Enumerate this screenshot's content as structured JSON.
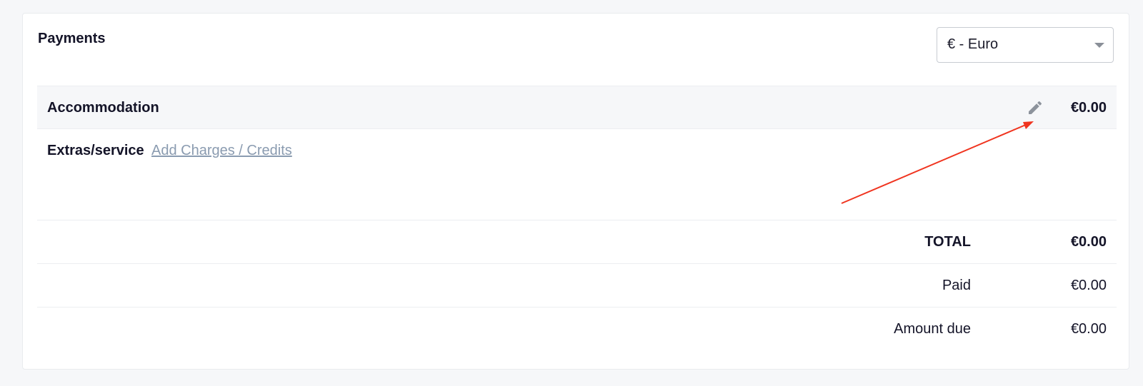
{
  "payments": {
    "title": "Payments",
    "currency": {
      "selected": "€ - Euro"
    },
    "accommodation": {
      "label": "Accommodation",
      "amount": "€0.00"
    },
    "extras": {
      "label": "Extras/service",
      "link": "Add Charges / Credits"
    },
    "summary": {
      "total_label": "TOTAL",
      "total_amount": "€0.00",
      "paid_label": "Paid",
      "paid_amount": "€0.00",
      "due_label": "Amount due",
      "due_amount": "€0.00"
    }
  },
  "colors": {
    "annotation_arrow": "#f0341f",
    "link": "#8a9bb0",
    "row_highlight": "#f6f7f9"
  },
  "icons": {
    "edit": "pencil-icon",
    "dropdown": "chevron-down-icon"
  }
}
